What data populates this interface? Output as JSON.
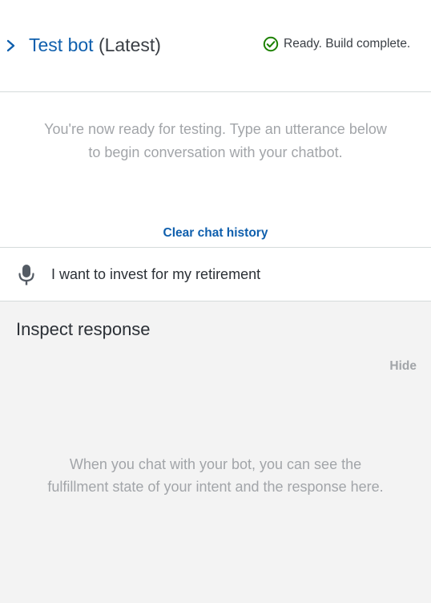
{
  "header": {
    "title_name": "Test bot",
    "title_version": "(Latest)",
    "status_text": "Ready. Build complete.",
    "collapse_icon": "chevron-right-icon",
    "status_icon": "check-circle-icon"
  },
  "chat": {
    "ready_line1": "You're now ready for testing. Type an utterance below",
    "ready_line2": "to begin conversation with your chatbot.",
    "clear_history_label": "Clear chat history"
  },
  "input": {
    "value": "I want to invest for my retirement",
    "mic_icon": "microphone-icon"
  },
  "inspect": {
    "title": "Inspect response",
    "hide_label": "Hide",
    "message_line1": "When you chat with your bot, you can see the",
    "message_line2": "fulfillment state of your intent and the response here."
  },
  "colors": {
    "link_blue": "#0f5fad",
    "success_green": "#1d8102",
    "muted_text": "#a2a5a9",
    "inspect_background": "#f3f3f3",
    "divider": "#d5dbdb"
  }
}
